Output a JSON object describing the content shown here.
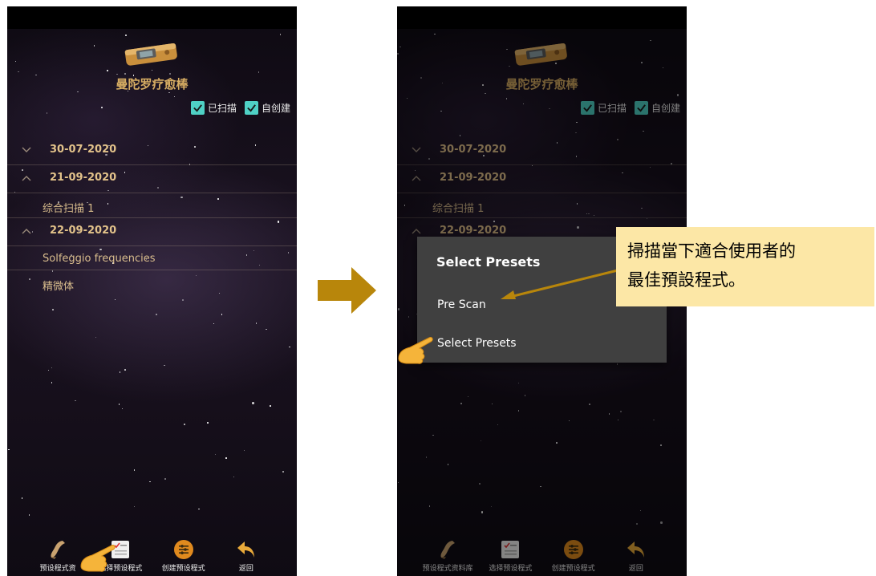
{
  "app": {
    "title": "曼陀罗疗愈棒",
    "filters": [
      {
        "label": "已扫描",
        "checked": true
      },
      {
        "label": "自创建",
        "checked": true
      }
    ]
  },
  "list": {
    "groups": [
      {
        "date": "30-07-2020",
        "expanded": false,
        "items": []
      },
      {
        "date": "21-09-2020",
        "expanded": true,
        "items": [
          "综合扫描 1"
        ]
      },
      {
        "date": "22-09-2020",
        "expanded": true,
        "items": [
          "Solfeggio frequencies",
          "精微体"
        ]
      }
    ]
  },
  "bottom_nav": {
    "left": [
      {
        "label": "预设程式资",
        "icon": "scroll-icon"
      },
      {
        "label": "选择预设程式",
        "icon": "checklist-icon"
      },
      {
        "label": "创建预设程式",
        "icon": "sliders-icon"
      },
      {
        "label": "返回",
        "icon": "return-icon"
      }
    ],
    "right": [
      {
        "label": "预设程式资料库",
        "icon": "scroll-icon"
      },
      {
        "label": "选择预设程式",
        "icon": "checklist-icon"
      },
      {
        "label": "创建预设程式",
        "icon": "sliders-icon"
      },
      {
        "label": "返回",
        "icon": "return-icon"
      }
    ]
  },
  "dialog": {
    "title": "Select Presets",
    "options": [
      "Pre Scan",
      "Select Presets"
    ]
  },
  "callout": {
    "line1": "掃描當下適合使用者的",
    "line2": "最佳預設程式。"
  },
  "colors": {
    "accent_gold": "#d7ad63",
    "checkbox": "#4fd1c5",
    "callout_bg": "#fce7a6",
    "arrow": "#b8860b"
  }
}
